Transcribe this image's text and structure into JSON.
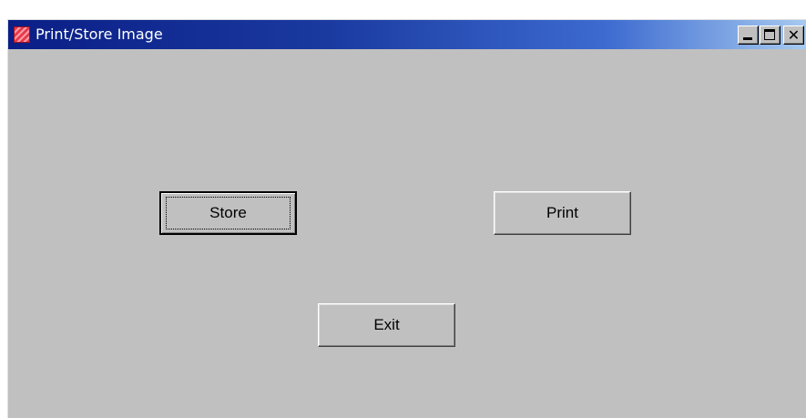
{
  "window": {
    "title": "Print/Store Image",
    "icon": "app-image-icon",
    "controls": {
      "minimize": "minimize-icon",
      "maximize": "maximize-icon",
      "close_label": "✕"
    }
  },
  "buttons": {
    "store_label": "Store",
    "print_label": "Print",
    "exit_label": "Exit"
  },
  "colors": {
    "window_background": "#c0c0c0",
    "titlebar_start": "#0a1e86",
    "titlebar_end": "#a6caf0"
  }
}
